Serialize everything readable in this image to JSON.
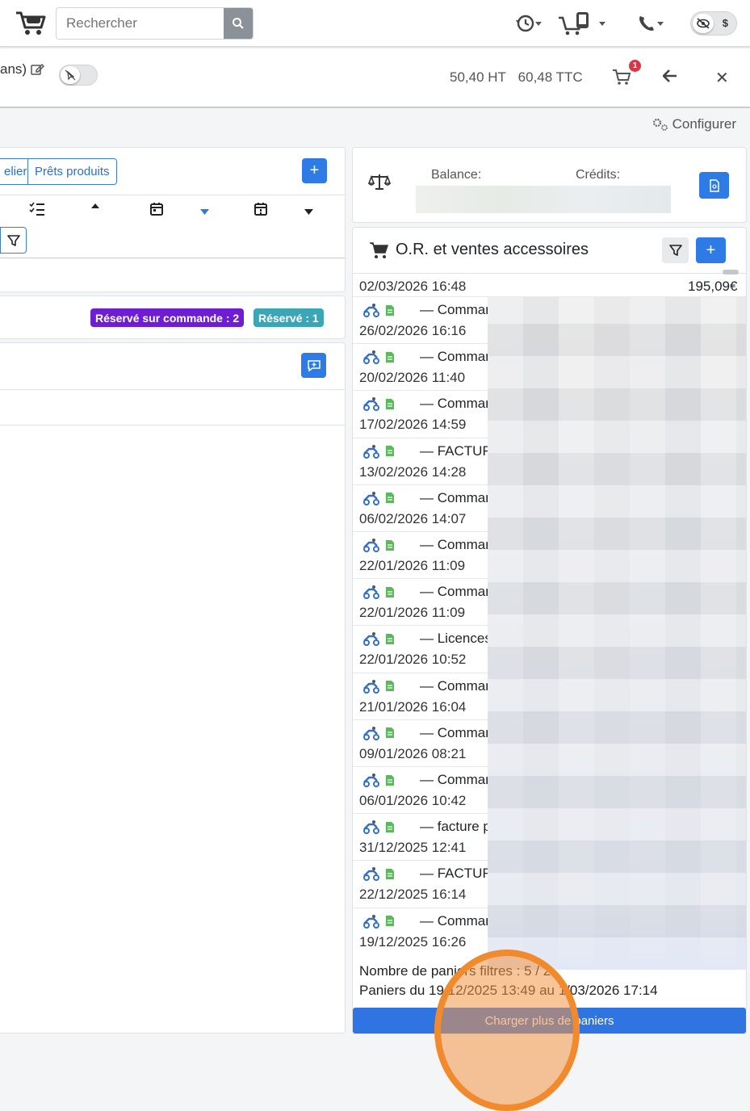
{
  "topbar": {
    "search": {
      "placeholder": "Rechercher",
      "value": ""
    }
  },
  "subbar": {
    "title": "ans)",
    "total_ht": "50,40 HT",
    "total_ttc": "60,48 TTC",
    "cart_count": "1"
  },
  "config": {
    "label": "Configurer"
  },
  "left": {
    "tabs": [
      "elier",
      "Prêts produits"
    ],
    "tags": [
      {
        "label": "Réservé sur commande : 2",
        "color": "#6f1dd4"
      },
      {
        "label": "Réservé : 1",
        "color": "#3ba6b5"
      }
    ]
  },
  "balance": {
    "balance_label": "Balance:",
    "credits_label": "Crédits:"
  },
  "orders": {
    "title": "O.R. et ventes accessoires",
    "first": {
      "date": "02/03/2026 16:48",
      "amount": "195,09€"
    },
    "rows": [
      {
        "label": "— Commande",
        "date": "26/02/2026 16:16"
      },
      {
        "label": "— Commande",
        "date": "20/02/2026 11:40"
      },
      {
        "label": "— Commande",
        "date": "17/02/2026 14:59"
      },
      {
        "label": "— FACTURE F",
        "date": "13/02/2026 14:28"
      },
      {
        "label": "— Commande",
        "date": "06/02/2026 14:07"
      },
      {
        "label": "— Commande",
        "date": "22/01/2026 11:09"
      },
      {
        "label": "— Commande",
        "date": "22/01/2026 11:09"
      },
      {
        "label": "— Licences B",
        "date": "22/01/2026 10:52"
      },
      {
        "label": "— Commande",
        "date": "21/01/2026 16:04"
      },
      {
        "label": "— Commande",
        "date": "09/01/2026 08:21"
      },
      {
        "label": "— Commande",
        "date": "06/01/2026 10:42"
      },
      {
        "label": "— facture pai",
        "date": "31/12/2025 12:41"
      },
      {
        "label": "— FACTURE F",
        "date": "22/12/2025 16:14"
      },
      {
        "label": "— Commande",
        "date": "19/12/2025 16:26"
      }
    ],
    "summary_count": "Nombre de paniers filtres : 5 / 2",
    "summary_range": "Paniers du 19/12/2025 13:49 au 1/03/2026 17:14",
    "load_more": "Charger plus de paniers"
  },
  "colors": {
    "accent": "#2f7be6",
    "danger": "#dc3545",
    "highlight": "#f08a2c"
  }
}
